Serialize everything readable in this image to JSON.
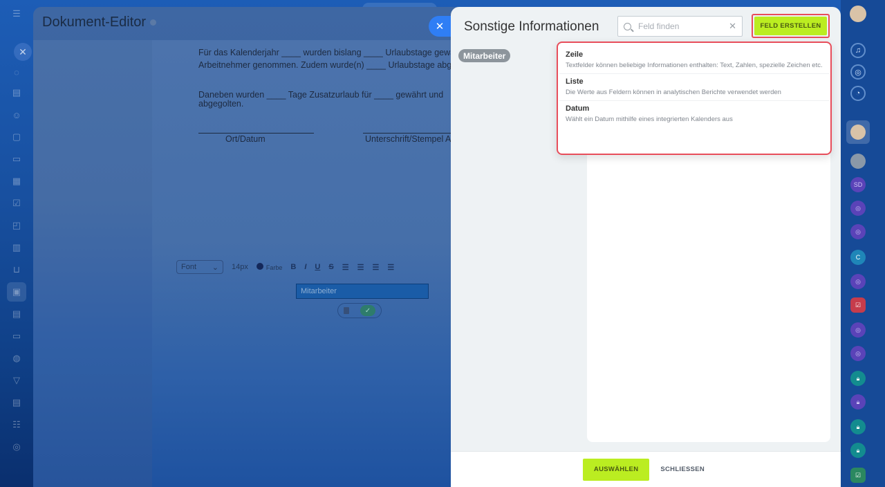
{
  "editor": {
    "title": "Dokument-Editor",
    "doc_lines": [
      "Für das Kalenderjahr ____ wurden bislang ____ Urlaubstage gewa",
      "Arbeitnehmer genommen. Zudem wurde(n) ____ Urlaubstage abgegolt",
      "Daneben wurden ____ Tage Zusatzurlaub für ____ gewährt und",
      "abgegolten."
    ],
    "sig_left": "Ort/Datum",
    "sig_right": "Unterschrift/Stempel Arb",
    "toolbar": {
      "font": "Font",
      "size": "14px",
      "color_label": "Farbe",
      "bold": "B",
      "italic": "I",
      "underline": "U",
      "strike": "S"
    },
    "field_chip": "Mitarbeiter"
  },
  "panel": {
    "title": "Sonstige Informationen",
    "search_placeholder": "Feld finden",
    "create_button": "FELD ERSTELLEN",
    "tag": "Mitarbeiter",
    "menu": [
      {
        "title": "Zeile",
        "desc": "Textfelder können beliebige Informationen enthalten: Text, Zahlen, spezielle Zeichen etc."
      },
      {
        "title": "Liste",
        "desc": "Die Werte aus Feldern können in analytischen Berichte verwendet werden"
      },
      {
        "title": "Datum",
        "desc": "Wählt ein Datum mithilfe eines integrierten Kalenders aus"
      }
    ],
    "select_button": "AUSWÄHLEN",
    "close_button": "SCHLIESSEN"
  },
  "rightbar": {
    "sd_label": "SD",
    "c_label": "C"
  },
  "colors": {
    "accent_green": "#bbed21",
    "highlight_red": "#e84d5a",
    "close_blue": "#2f7ef5"
  }
}
